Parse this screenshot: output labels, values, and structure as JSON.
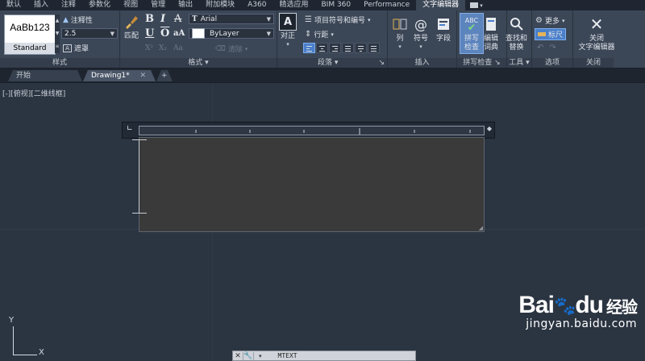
{
  "menu_tabs": [
    "默认",
    "插入",
    "注释",
    "参数化",
    "视图",
    "管理",
    "输出",
    "附加模块",
    "A360",
    "精选应用",
    "BIM 360",
    "Performance",
    "文字编辑器"
  ],
  "menu_active": "文字编辑器",
  "ribbon": {
    "style_panel": {
      "preview_text": "AaBb123",
      "style_name": "Standard",
      "annotative_label": "注释性",
      "height_value": "2.5",
      "mask_label": "遮罩",
      "title": "样式"
    },
    "format_panel": {
      "match_label": "匹配",
      "bold": "B",
      "italic": "I",
      "strike": "A",
      "underline": "U",
      "overline": "O",
      "case": "aA",
      "font_value": "Arial",
      "color_value": "ByLayer",
      "clear_label": "清除",
      "title": "格式"
    },
    "paragraph_panel": {
      "justify_label": "对正",
      "bullets_label": "项目符号和编号",
      "line_spacing_label": "行距",
      "title": "段落"
    },
    "insert_panel": {
      "columns_label": "列",
      "symbol_label": "符号",
      "field_label": "字段",
      "title": "插入"
    },
    "spell_panel": {
      "spell_label": "拼写\n检查",
      "edit_dict_label": "编辑\n词典",
      "title": "拼写检查"
    },
    "tools_panel": {
      "find_label": "查找和\n替换",
      "title": "工具"
    },
    "options_panel": {
      "more_label": "更多",
      "ruler_label": "标尺",
      "title": "选项"
    },
    "close_panel": {
      "close_label": "关闭\n文字编辑器",
      "title": "关闭"
    }
  },
  "doc_tabs": [
    {
      "label": "开始",
      "active": false
    },
    {
      "label": "Drawing1*",
      "active": true
    }
  ],
  "viewport_label": "[-][俯视][二维线框]",
  "ucs": {
    "x": "X",
    "y": "Y"
  },
  "command_prompt": "MTEXT",
  "watermark": {
    "logo": "Bai",
    "logo2": "du",
    "logo_zh": "经验",
    "url": "jingyan.baidu.com"
  },
  "colors": {
    "accent": "#4a7fc9",
    "ribbon_bg": "#3b4656",
    "canvas_bg": "#2b3441"
  }
}
